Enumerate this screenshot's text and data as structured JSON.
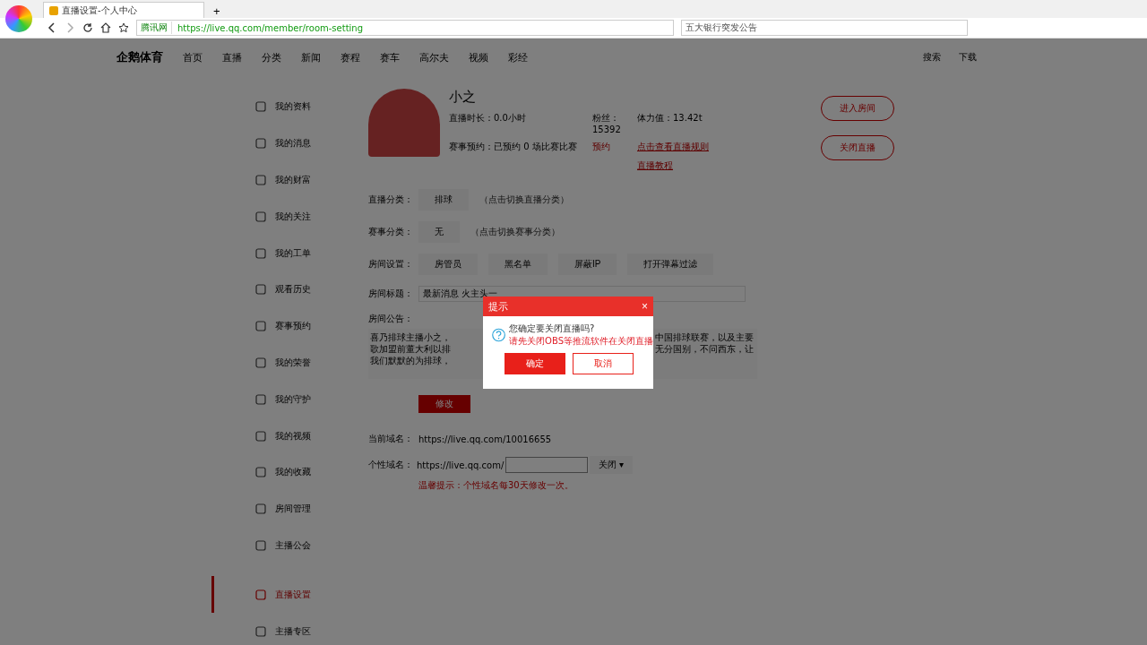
{
  "browser": {
    "tab_title": "直播设置-个人中心",
    "new_tab": "+",
    "site_badge": "腾讯网",
    "url": "https://live.qq.com/member/room-setting",
    "search_placeholder": "五大银行突发公告"
  },
  "site_nav": {
    "logo": "企鹅体育",
    "items": [
      "首页",
      "直播",
      "分类",
      "新闻",
      "赛程",
      "赛车",
      "高尔夫",
      "视频",
      "彩经"
    ],
    "search": "搜索",
    "download": "下载"
  },
  "sidebar": {
    "items": [
      {
        "label": "我的资料",
        "selected": false
      },
      {
        "label": "我的消息",
        "selected": false
      },
      {
        "label": "我的财富",
        "selected": false
      },
      {
        "label": "我的关注",
        "selected": false
      },
      {
        "label": "我的工单",
        "selected": false
      },
      {
        "label": "观看历史",
        "selected": false
      },
      {
        "label": "赛事预约",
        "selected": false
      },
      {
        "label": "我的荣誉",
        "selected": false
      },
      {
        "label": "我的守护",
        "selected": false
      },
      {
        "label": "我的视频",
        "selected": false
      },
      {
        "label": "我的收藏",
        "selected": false
      },
      {
        "label": "房间管理",
        "selected": false
      },
      {
        "label": "主播公会",
        "selected": false
      },
      {
        "label": "直播设置",
        "selected": true
      },
      {
        "label": "主播专区",
        "selected": false
      }
    ]
  },
  "profile": {
    "name": "小之",
    "duration": "直播时长：0.0小时",
    "fans": "粉丝：15392",
    "stamina": "体力值：13.42t",
    "booking": "赛事预约：已预约 0 场比赛比赛",
    "booking_link": "预约",
    "rules_link": "点击查看直播规则",
    "tutorial_link": "直播教程",
    "buttons": [
      "进入房间",
      "关闭直播"
    ]
  },
  "form": {
    "category_label": "直播分类：",
    "category_value": "排球",
    "category_hint": "（点击切换直播分类）",
    "match_label": "赛事分类：",
    "match_value": "无",
    "match_hint": "（点击切换赛事分类）",
    "room_label": "房间设置：",
    "room_buttons": [
      "房管员",
      "黑名单",
      "屏蔽IP",
      "打开弹幕过滤"
    ],
    "title_label": "房间标题：",
    "title_value": "最新消息 火主头一",
    "notice_label": "房间公告：",
    "notice_left": [
      "喜乃排球主播小之，",
      "歌加盟前董大利以排",
      "我们默默的为排球，"
    ],
    "notice_right": [
      "中国排球联赛，以及主要",
      "无分国别，不问西东，让"
    ],
    "save": "修改",
    "domain_label": "当前域名：",
    "domain_value": "https://live.qq.com/10016655",
    "custom_label": "个性域名：",
    "custom_prefix": "https://live.qq.com/",
    "custom_select": "关闭",
    "select_caret": "▾",
    "custom_note": "温馨提示：个性域名每30天修改一次。"
  },
  "dialog": {
    "title": "提示",
    "close": "×",
    "question": "您确定要关闭直播吗?",
    "warning": "请先关闭OBS等推流软件在关闭直播",
    "confirm": "确定",
    "cancel": "取消"
  }
}
